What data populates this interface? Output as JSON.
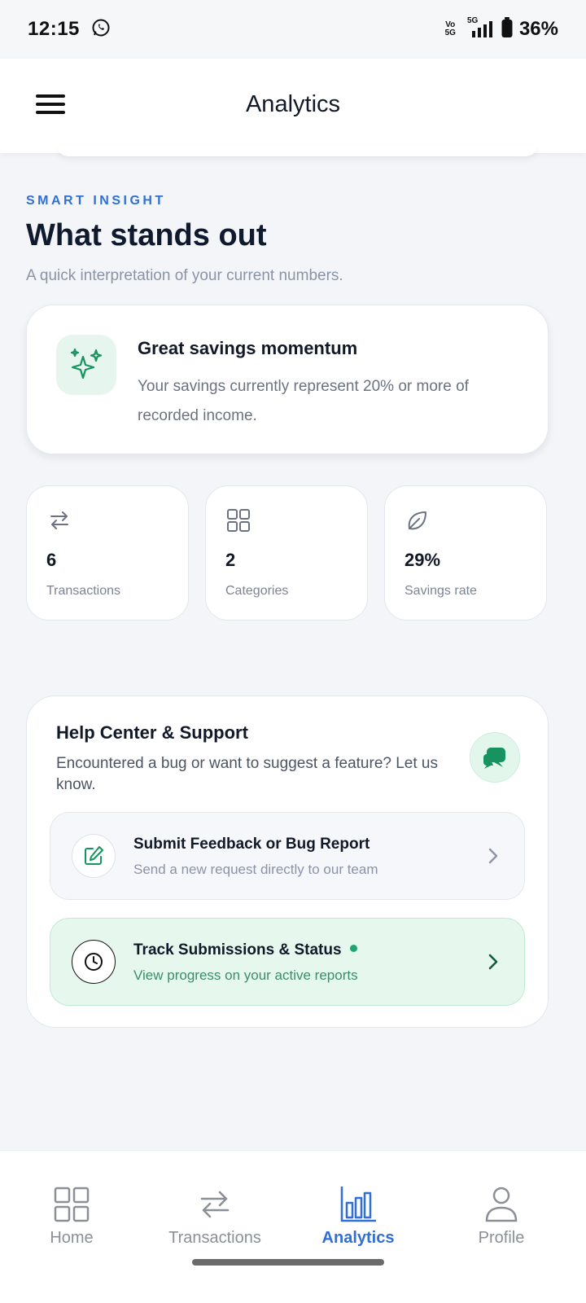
{
  "status_bar": {
    "time": "12:15",
    "network_top": "Vo",
    "network_bottom": "5G",
    "signal_label": "5G",
    "battery_percent": "36%"
  },
  "app_bar": {
    "title": "Analytics"
  },
  "insight": {
    "eyebrow": "SMART INSIGHT",
    "heading": "What stands out",
    "subheading": "A quick interpretation of your current numbers.",
    "card": {
      "title": "Great savings momentum",
      "text": "Your savings currently represent 20% or more of recorded income.",
      "icon": "sparkles-icon"
    }
  },
  "stats": [
    {
      "icon": "swap-arrows-icon",
      "value": "6",
      "label": "Transactions"
    },
    {
      "icon": "grid-icon",
      "value": "2",
      "label": "Categories"
    },
    {
      "icon": "leaf-icon",
      "value": "29%",
      "label": "Savings rate"
    }
  ],
  "help": {
    "title": "Help Center & Support",
    "text": "Encountered a bug or want to suggest a feature? Let us know.",
    "feedback": {
      "title": "Submit Feedback or Bug Report",
      "subtitle": "Send a new request directly to our team"
    },
    "track": {
      "title": "Track Submissions & Status",
      "subtitle": "View progress on your active reports"
    }
  },
  "bottom_nav": {
    "active": "Analytics",
    "items": [
      {
        "label": "Home",
        "icon": "grid-icon"
      },
      {
        "label": "Transactions",
        "icon": "swap-arrows-icon"
      },
      {
        "label": "Analytics",
        "icon": "bar-chart-icon"
      },
      {
        "label": "Profile",
        "icon": "user-icon"
      }
    ]
  },
  "colors": {
    "accent_blue": "#2f6fd6",
    "accent_green": "#1ea672",
    "background": "#f3f5f8"
  }
}
